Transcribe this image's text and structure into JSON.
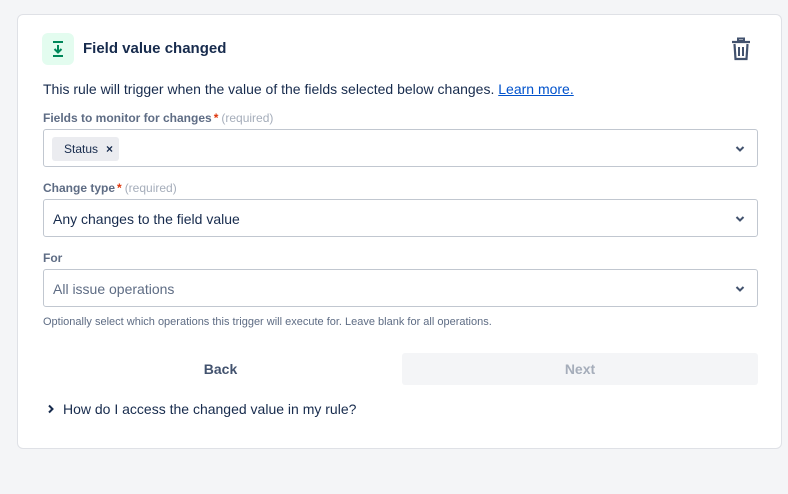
{
  "trigger": {
    "title": "Field value changed",
    "icon": "field-changed-icon",
    "icon_color": "#00875a",
    "icon_bg": "#e3fcef"
  },
  "description": {
    "text": "This rule will trigger when the value of the fields selected below changes.",
    "link": "Learn more."
  },
  "fields_monitor": {
    "label": "Fields to monitor for changes",
    "required_star": "*",
    "required_hint": "(required)",
    "tags": [
      "Status"
    ],
    "tag_remove": "×"
  },
  "change_type": {
    "label": "Change type",
    "required_star": "*",
    "required_hint": "(required)",
    "value": "Any changes to the field value"
  },
  "for": {
    "label": "For",
    "placeholder": "All issue operations",
    "help": "Optionally select which operations this trigger will execute for. Leave blank for all operations."
  },
  "buttons": {
    "back": "Back",
    "next": "Next"
  },
  "faq": {
    "label": "How do I access the changed value in my rule?"
  },
  "colors": {
    "link": "#0052cc",
    "required": "#de350b",
    "disabled_text": "#a5adba"
  }
}
